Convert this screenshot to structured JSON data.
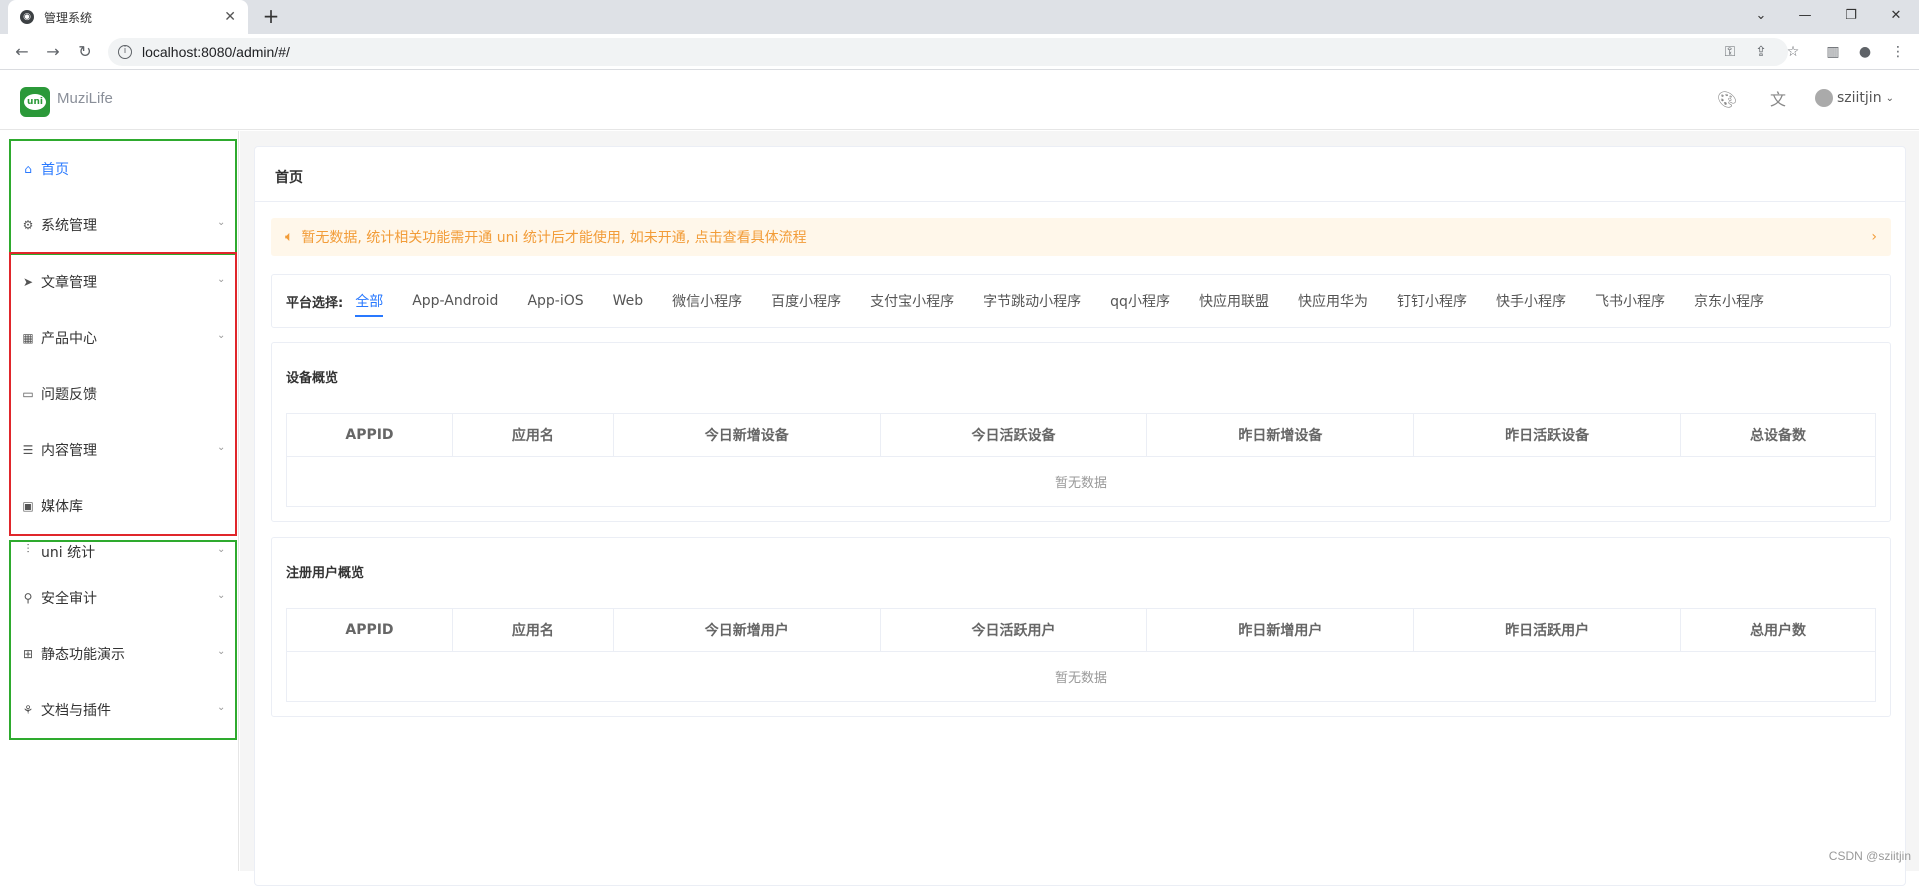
{
  "browser": {
    "tab_title": "管理系统",
    "url": "localhost:8080/admin/#/"
  },
  "header": {
    "logo_text": "uni",
    "brand": "MuziLife",
    "username": "sziitjin"
  },
  "sidebar": {
    "groups": [
      {
        "color": "#2eaa2e",
        "items": [
          {
            "label": "首页",
            "icon": "home-icon",
            "active": true,
            "expandable": false
          },
          {
            "label": "系统管理",
            "icon": "gear-icon",
            "expandable": true
          }
        ]
      },
      {
        "color": "#e0262b",
        "items": [
          {
            "label": "文章管理",
            "icon": "send-icon",
            "expandable": true
          },
          {
            "label": "产品中心",
            "icon": "map-icon",
            "expandable": true
          },
          {
            "label": "问题反馈",
            "icon": "chat-icon",
            "expandable": false
          },
          {
            "label": "内容管理",
            "icon": "list-icon",
            "expandable": true
          },
          {
            "label": "媒体库",
            "icon": "image-icon",
            "expandable": false
          }
        ]
      },
      {
        "color": "#2eaa2e",
        "items": [
          {
            "label": "uni 统计",
            "icon": "chart-icon",
            "expandable": true
          },
          {
            "label": "安全审计",
            "icon": "user-icon",
            "expandable": true
          },
          {
            "label": "静态功能演示",
            "icon": "grid-icon",
            "expandable": true
          },
          {
            "label": "文档与插件",
            "icon": "plugin-icon",
            "expandable": true
          }
        ]
      }
    ]
  },
  "main": {
    "page_title": "首页",
    "notice": "暂无数据, 统计相关功能需开通 uni 统计后才能使用, 如未开通, 点击查看具体流程",
    "platform_label": "平台选择:",
    "platforms": [
      "全部",
      "App-Android",
      "App-iOS",
      "Web",
      "微信小程序",
      "百度小程序",
      "支付宝小程序",
      "字节跳动小程序",
      "qq小程序",
      "快应用联盟",
      "快应用华为",
      "钉钉小程序",
      "快手小程序",
      "飞书小程序",
      "京东小程序"
    ],
    "active_platform": "全部",
    "device_overview": {
      "title": "设备概览",
      "columns": [
        "APPID",
        "应用名",
        "今日新增设备",
        "今日活跃设备",
        "昨日新增设备",
        "昨日活跃设备",
        "总设备数"
      ],
      "empty_text": "暂无数据"
    },
    "user_overview": {
      "title": "注册用户概览",
      "columns": [
        "APPID",
        "应用名",
        "今日新增用户",
        "今日活跃用户",
        "昨日新增用户",
        "昨日活跃用户",
        "总用户数"
      ],
      "empty_text": "暂无数据"
    }
  },
  "watermark": "CSDN @sziitjin",
  "colors": {
    "accent": "#2979ff",
    "notice_text": "#f29c38",
    "notice_bg": "#fff7ea"
  }
}
